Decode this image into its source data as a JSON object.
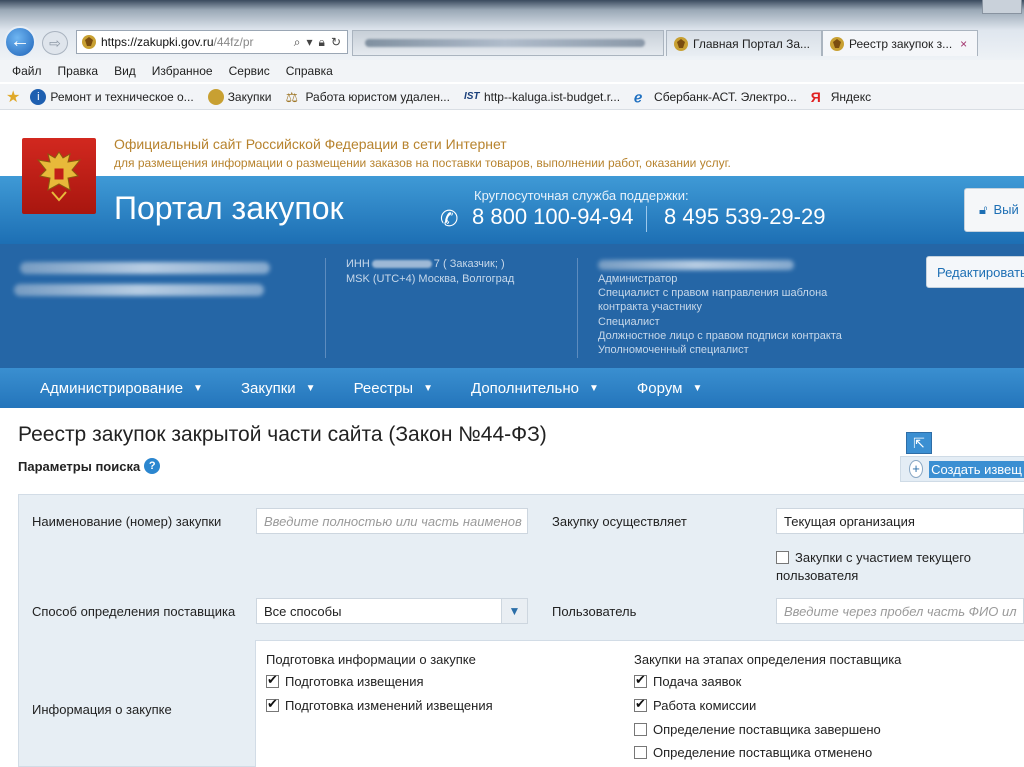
{
  "browser": {
    "url_host": "https://zakupki.gov.ru",
    "url_rest": "/44fz/pr",
    "tabs": [
      {
        "label": "Главная Портал За..."
      },
      {
        "label": "Реестр закупок з...",
        "close": "×"
      }
    ],
    "menu": [
      "Файл",
      "Правка",
      "Вид",
      "Избранное",
      "Сервис",
      "Справка"
    ],
    "favorites": [
      {
        "label": "Ремонт и техническое о...",
        "icon": "info-icon"
      },
      {
        "label": "Закупки",
        "icon": "eagle-icon"
      },
      {
        "label": "Работа юристом удален...",
        "icon": "scales-icon"
      },
      {
        "label": "http--kaluga.ist-budget.r...",
        "icon": "ist-icon"
      },
      {
        "label": "Сбербанк-АСТ. Электро...",
        "icon": "ie-page-icon"
      },
      {
        "label": "Яндекс",
        "icon": "yandex-icon"
      }
    ]
  },
  "header": {
    "line1": "Официальный сайт Российской Федерации в сети Интернет",
    "line2": "для размещения информации о размещении заказов на поставки товаров, выполнении работ, оказании услуг.",
    "portal_title": "Портал закупок",
    "support_label": "Круглосуточная служба поддержки:",
    "phone1": "8 800 100-94-94",
    "phone2": "8 495 539-29-29",
    "logout_label": "Вый"
  },
  "user": {
    "inn_label": "ИНН",
    "inn_suffix": "7 ( Заказчик; )",
    "timezone": "MSK (UTC+4) Москва, Волгоград",
    "roles": [
      "Администратор",
      "Специалист с правом направления шаблона",
      "контракта участнику",
      "Специалист",
      "Должностное лицо с правом подписи контракта",
      "Уполномоченный специалист"
    ],
    "edit_label": "Редактировать"
  },
  "nav": [
    {
      "label": "Администрирование"
    },
    {
      "label": "Закупки"
    },
    {
      "label": "Реестры"
    },
    {
      "label": "Дополнительно"
    },
    {
      "label": "Форум"
    }
  ],
  "page": {
    "title": "Реестр закупок закрытой части сайта (Закон №44-ФЗ)",
    "search_params": "Параметры поиска",
    "help": "?",
    "create_label": "Создать извещ"
  },
  "form": {
    "name_label": "Наименование (номер) закупки",
    "name_placeholder": "Введите полностью или часть наименов",
    "executor_label": "Закупку осуществляет",
    "executor_value": "Текущая организация",
    "participation_line1": "Закупки с участием текущего",
    "participation_line2": "пользователя",
    "method_label": "Способ определения поставщика",
    "method_value": "Все способы",
    "user_label": "Пользователь",
    "user_placeholder": "Введите через пробел часть ФИО ил",
    "info_label": "Информация о закупке",
    "group1": {
      "title": "Подготовка информации о закупке",
      "items": [
        {
          "label": "Подготовка извещения",
          "checked": true
        },
        {
          "label": "Подготовка изменений извещения",
          "checked": true
        }
      ]
    },
    "group2": {
      "title": "Закупки на этапах определения поставщика",
      "items": [
        {
          "label": "Подача заявок",
          "checked": true
        },
        {
          "label": "Работа комиссии",
          "checked": true
        },
        {
          "label": "Определение поставщика завершено",
          "checked": false
        },
        {
          "label": "Определение поставщика отменено",
          "checked": false
        }
      ]
    }
  },
  "colors": {
    "brand_blue": "#2475bb",
    "user_band": "#2566a6",
    "gold_text": "#b7832e",
    "coat_red": "#c21f17"
  }
}
